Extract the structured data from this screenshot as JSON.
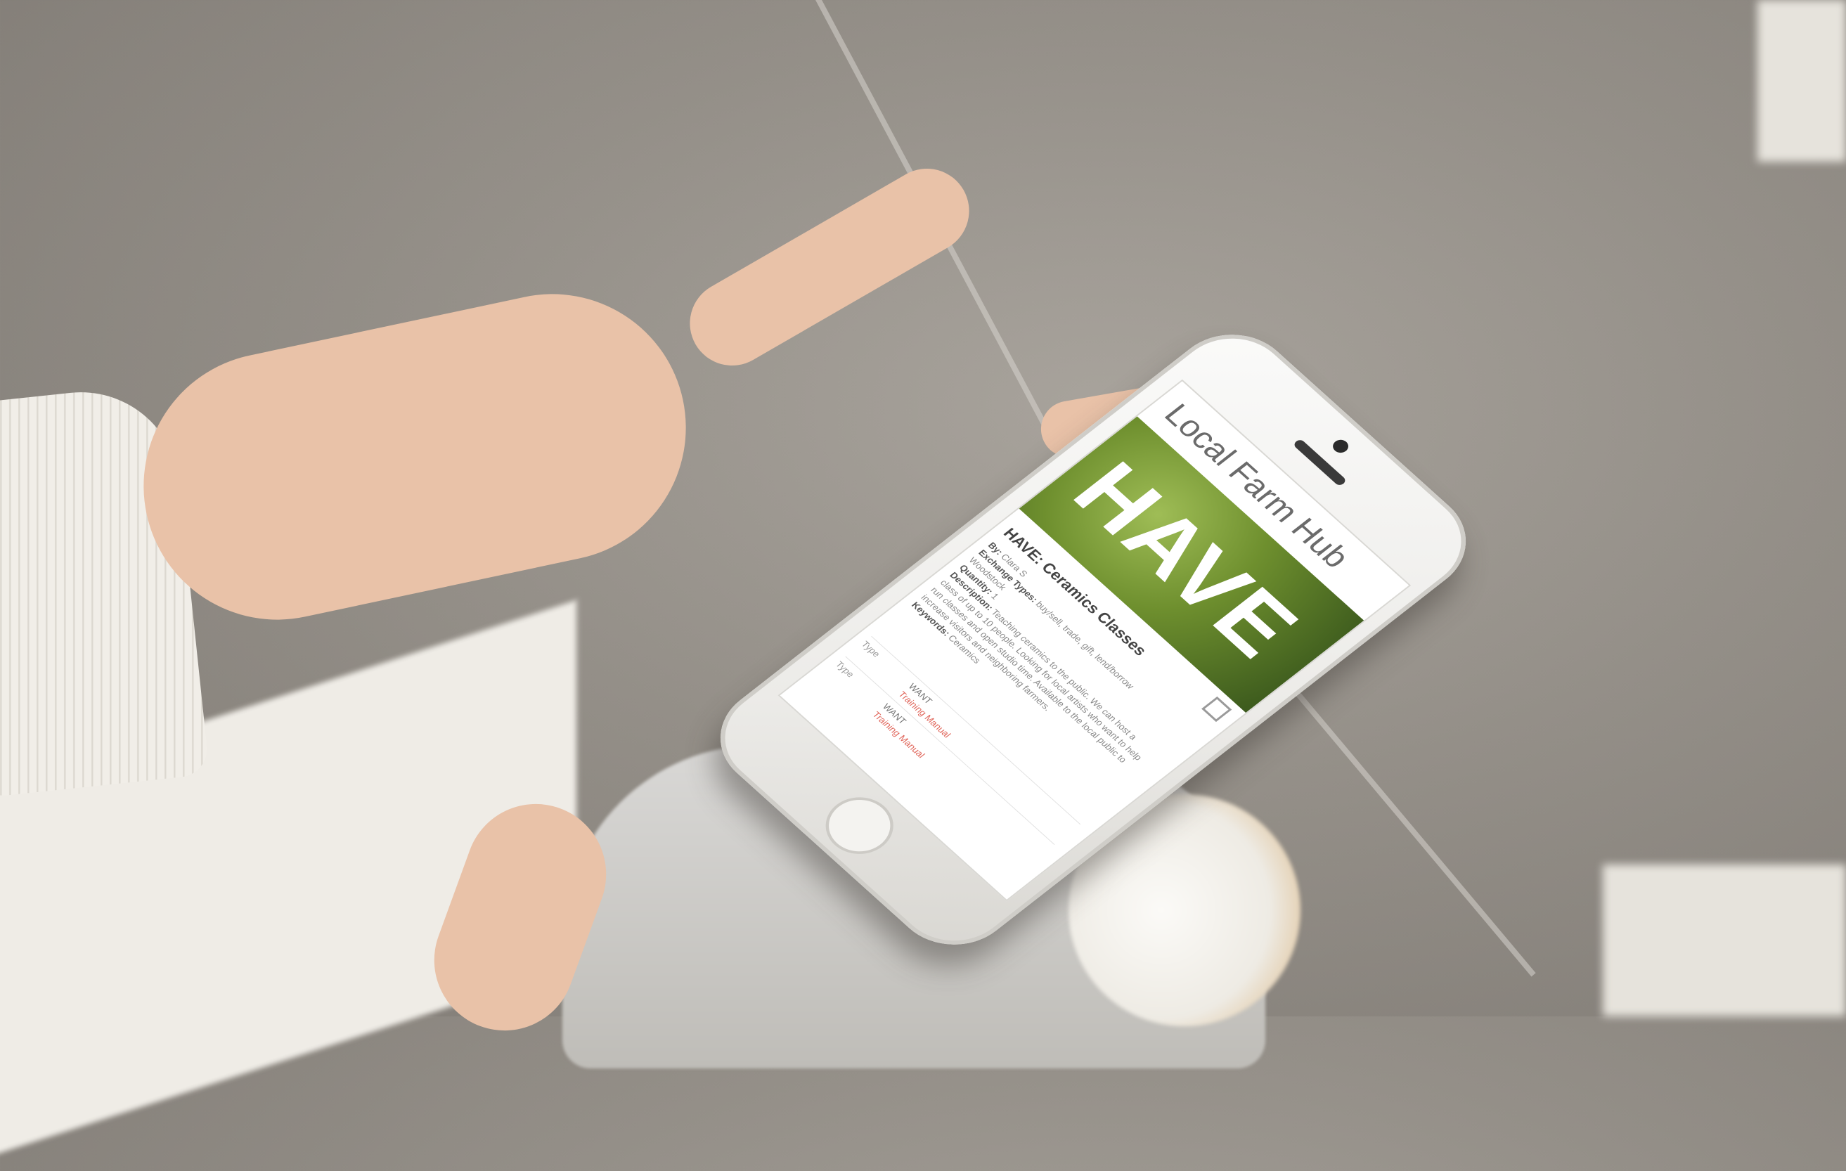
{
  "app": {
    "title": "Local Farm Hub",
    "hero_word": "HAVE"
  },
  "listing": {
    "heading": "HAVE: Ceramics Classes",
    "by_label": "By:",
    "by_value": "Clara S",
    "exchange_label": "Exchange Types:",
    "exchange_value": "buy/sell, trade, gift, lend/borrow",
    "location_value": "Woodstock",
    "quantity_label": "Quantity:",
    "quantity_value": "1",
    "description_label": "Description:",
    "description_value": "Teaching ceramics to the public. We can host a class of up to 10 people. Looking for local artists who want to help run classes and open studio time. Available to the local public to increase visitors and neighboring farmers.",
    "keywords_label": "Keywords:",
    "keywords_value": "Ceramics"
  },
  "related": [
    {
      "type_label": "Type",
      "type_value": "WANT",
      "link": "Training Manual"
    },
    {
      "type_label": "Type",
      "type_value": "WANT",
      "link": "Training Manual"
    }
  ],
  "colors": {
    "link": "#e0655a",
    "hero_green": "#6e8f2e"
  }
}
